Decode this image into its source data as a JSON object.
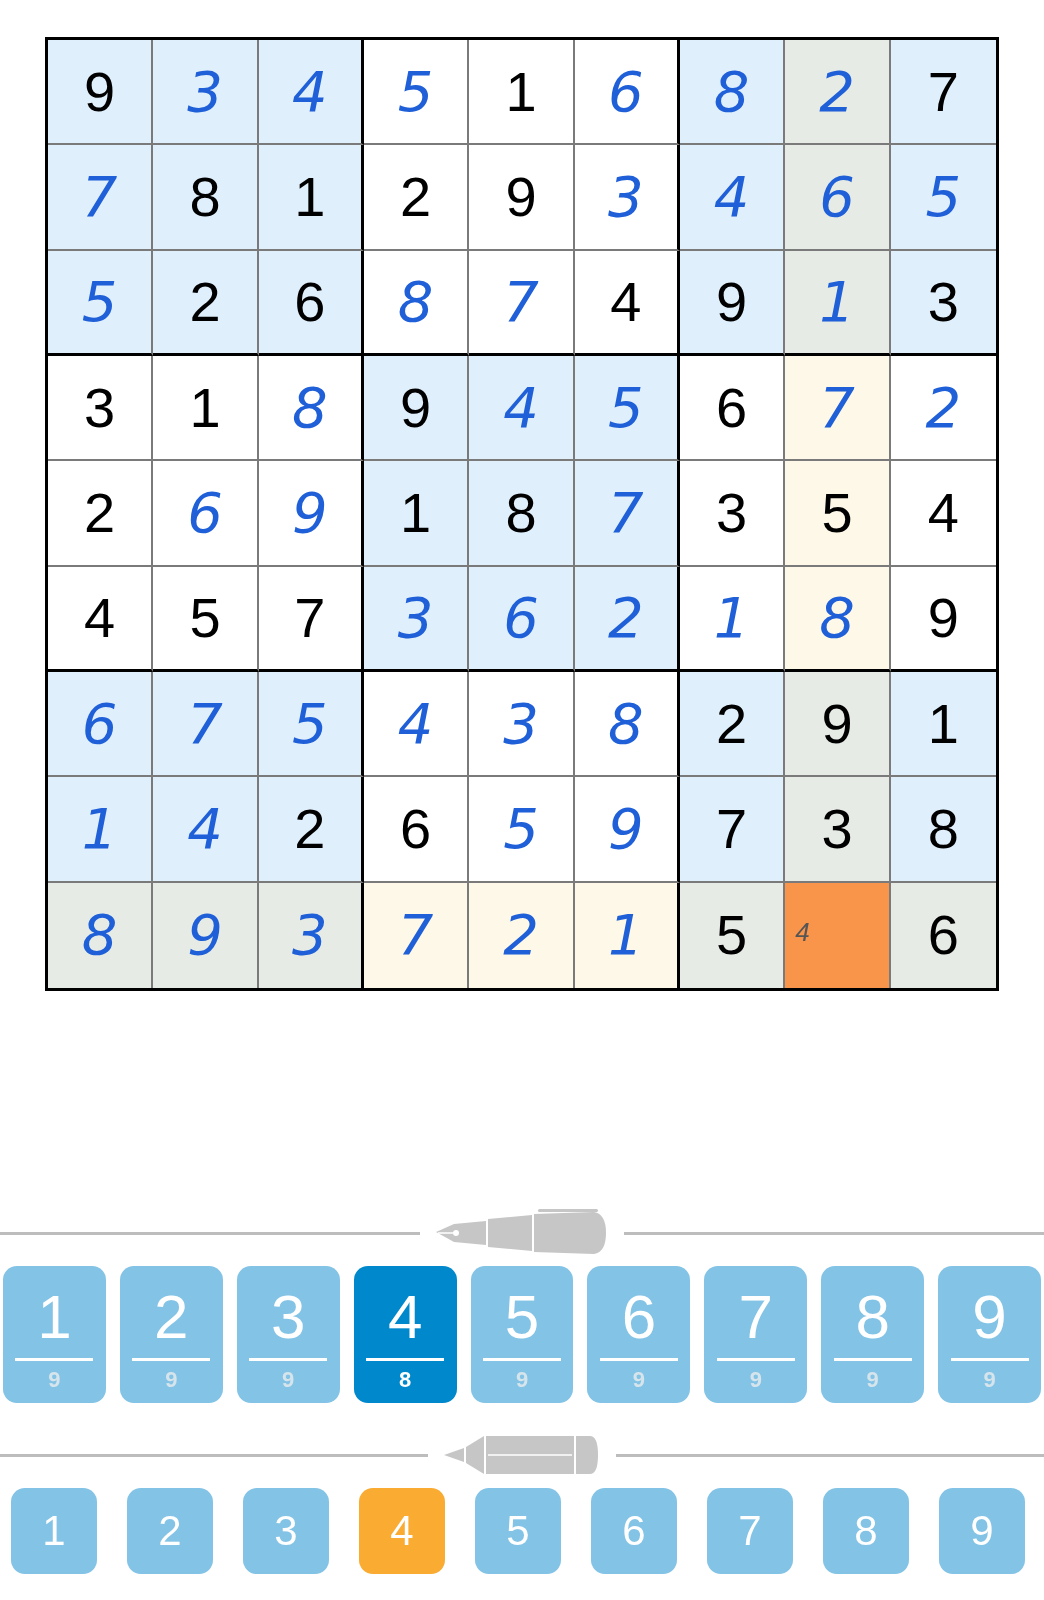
{
  "board": [
    [
      {
        "value": "9",
        "kind": "given",
        "color": "#dfeffc"
      },
      {
        "value": "3",
        "kind": "entered",
        "color": "#dfeffc"
      },
      {
        "value": "4",
        "kind": "entered",
        "color": "#dfeffc"
      },
      {
        "value": "5",
        "kind": "entered",
        "color": "#ffffff"
      },
      {
        "value": "1",
        "kind": "given",
        "color": "#ffffff"
      },
      {
        "value": "6",
        "kind": "entered",
        "color": "#ffffff"
      },
      {
        "value": "8",
        "kind": "entered",
        "color": "#dfeffc"
      },
      {
        "value": "2",
        "kind": "entered",
        "color": "#e6ebe5"
      },
      {
        "value": "7",
        "kind": "given",
        "color": "#dfeffc"
      }
    ],
    [
      {
        "value": "7",
        "kind": "entered",
        "color": "#dfeffc"
      },
      {
        "value": "8",
        "kind": "given",
        "color": "#dfeffc"
      },
      {
        "value": "1",
        "kind": "given",
        "color": "#dfeffc"
      },
      {
        "value": "2",
        "kind": "given",
        "color": "#ffffff"
      },
      {
        "value": "9",
        "kind": "given",
        "color": "#ffffff"
      },
      {
        "value": "3",
        "kind": "entered",
        "color": "#ffffff"
      },
      {
        "value": "4",
        "kind": "entered",
        "color": "#dfeffc"
      },
      {
        "value": "6",
        "kind": "entered",
        "color": "#e6ebe5"
      },
      {
        "value": "5",
        "kind": "entered",
        "color": "#dfeffc"
      }
    ],
    [
      {
        "value": "5",
        "kind": "entered",
        "color": "#dfeffc"
      },
      {
        "value": "2",
        "kind": "given",
        "color": "#dfeffc"
      },
      {
        "value": "6",
        "kind": "given",
        "color": "#dfeffc"
      },
      {
        "value": "8",
        "kind": "entered",
        "color": "#ffffff"
      },
      {
        "value": "7",
        "kind": "entered",
        "color": "#ffffff"
      },
      {
        "value": "4",
        "kind": "given",
        "color": "#ffffff"
      },
      {
        "value": "9",
        "kind": "given",
        "color": "#dfeffc"
      },
      {
        "value": "1",
        "kind": "entered",
        "color": "#e6ebe5"
      },
      {
        "value": "3",
        "kind": "given",
        "color": "#dfeffc"
      }
    ],
    [
      {
        "value": "3",
        "kind": "given",
        "color": "#ffffff"
      },
      {
        "value": "1",
        "kind": "given",
        "color": "#ffffff"
      },
      {
        "value": "8",
        "kind": "entered",
        "color": "#ffffff"
      },
      {
        "value": "9",
        "kind": "given",
        "color": "#dfeffc"
      },
      {
        "value": "4",
        "kind": "entered",
        "color": "#dfeffc"
      },
      {
        "value": "5",
        "kind": "entered",
        "color": "#dfeffc"
      },
      {
        "value": "6",
        "kind": "given",
        "color": "#ffffff"
      },
      {
        "value": "7",
        "kind": "entered",
        "color": "#fdf8e7"
      },
      {
        "value": "2",
        "kind": "entered",
        "color": "#ffffff"
      }
    ],
    [
      {
        "value": "2",
        "kind": "given",
        "color": "#ffffff"
      },
      {
        "value": "6",
        "kind": "entered",
        "color": "#ffffff"
      },
      {
        "value": "9",
        "kind": "entered",
        "color": "#ffffff"
      },
      {
        "value": "1",
        "kind": "given",
        "color": "#dfeffc"
      },
      {
        "value": "8",
        "kind": "given",
        "color": "#dfeffc"
      },
      {
        "value": "7",
        "kind": "entered",
        "color": "#dfeffc"
      },
      {
        "value": "3",
        "kind": "given",
        "color": "#ffffff"
      },
      {
        "value": "5",
        "kind": "given",
        "color": "#fdf8e7"
      },
      {
        "value": "4",
        "kind": "given",
        "color": "#ffffff"
      }
    ],
    [
      {
        "value": "4",
        "kind": "given",
        "color": "#ffffff"
      },
      {
        "value": "5",
        "kind": "given",
        "color": "#ffffff"
      },
      {
        "value": "7",
        "kind": "given",
        "color": "#ffffff"
      },
      {
        "value": "3",
        "kind": "entered",
        "color": "#dfeffc"
      },
      {
        "value": "6",
        "kind": "entered",
        "color": "#dfeffc"
      },
      {
        "value": "2",
        "kind": "entered",
        "color": "#dfeffc"
      },
      {
        "value": "1",
        "kind": "entered",
        "color": "#ffffff"
      },
      {
        "value": "8",
        "kind": "entered",
        "color": "#fdf8e7"
      },
      {
        "value": "9",
        "kind": "given",
        "color": "#ffffff"
      }
    ],
    [
      {
        "value": "6",
        "kind": "entered",
        "color": "#dfeffc"
      },
      {
        "value": "7",
        "kind": "entered",
        "color": "#dfeffc"
      },
      {
        "value": "5",
        "kind": "entered",
        "color": "#dfeffc"
      },
      {
        "value": "4",
        "kind": "entered",
        "color": "#ffffff"
      },
      {
        "value": "3",
        "kind": "entered",
        "color": "#ffffff"
      },
      {
        "value": "8",
        "kind": "entered",
        "color": "#ffffff"
      },
      {
        "value": "2",
        "kind": "given",
        "color": "#dfeffc"
      },
      {
        "value": "9",
        "kind": "given",
        "color": "#e6ebe5"
      },
      {
        "value": "1",
        "kind": "given",
        "color": "#dfeffc"
      }
    ],
    [
      {
        "value": "1",
        "kind": "entered",
        "color": "#dfeffc"
      },
      {
        "value": "4",
        "kind": "entered",
        "color": "#dfeffc"
      },
      {
        "value": "2",
        "kind": "given",
        "color": "#dfeffc"
      },
      {
        "value": "6",
        "kind": "given",
        "color": "#ffffff"
      },
      {
        "value": "5",
        "kind": "entered",
        "color": "#ffffff"
      },
      {
        "value": "9",
        "kind": "entered",
        "color": "#ffffff"
      },
      {
        "value": "7",
        "kind": "given",
        "color": "#dfeffc"
      },
      {
        "value": "3",
        "kind": "given",
        "color": "#e6ebe5"
      },
      {
        "value": "8",
        "kind": "given",
        "color": "#dfeffc"
      }
    ],
    [
      {
        "value": "8",
        "kind": "entered",
        "color": "#e6ebe5"
      },
      {
        "value": "9",
        "kind": "entered",
        "color": "#e6ebe5"
      },
      {
        "value": "3",
        "kind": "entered",
        "color": "#e6ebe5"
      },
      {
        "value": "7",
        "kind": "entered",
        "color": "#fdf8e7"
      },
      {
        "value": "2",
        "kind": "entered",
        "color": "#fdf8e7"
      },
      {
        "value": "1",
        "kind": "entered",
        "color": "#fdf8e7"
      },
      {
        "value": "5",
        "kind": "given",
        "color": "#e6ebe5"
      },
      {
        "value": "4",
        "kind": "note",
        "color": "#f9944b"
      },
      {
        "value": "6",
        "kind": "given",
        "color": "#e6ebe5"
      }
    ]
  ],
  "pen_keys": [
    {
      "digit": "1",
      "count": "9",
      "selected": false
    },
    {
      "digit": "2",
      "count": "9",
      "selected": false
    },
    {
      "digit": "3",
      "count": "9",
      "selected": false
    },
    {
      "digit": "4",
      "count": "8",
      "selected": true
    },
    {
      "digit": "5",
      "count": "9",
      "selected": false
    },
    {
      "digit": "6",
      "count": "9",
      "selected": false
    },
    {
      "digit": "7",
      "count": "9",
      "selected": false
    },
    {
      "digit": "8",
      "count": "9",
      "selected": false
    },
    {
      "digit": "9",
      "count": "9",
      "selected": false
    }
  ],
  "pencil_keys": [
    {
      "digit": "1",
      "selected": false
    },
    {
      "digit": "2",
      "selected": false
    },
    {
      "digit": "3",
      "selected": false
    },
    {
      "digit": "4",
      "selected": true
    },
    {
      "digit": "5",
      "selected": false
    },
    {
      "digit": "6",
      "selected": false
    },
    {
      "digit": "7",
      "selected": false
    },
    {
      "digit": "8",
      "selected": false
    },
    {
      "digit": "9",
      "selected": false
    }
  ]
}
